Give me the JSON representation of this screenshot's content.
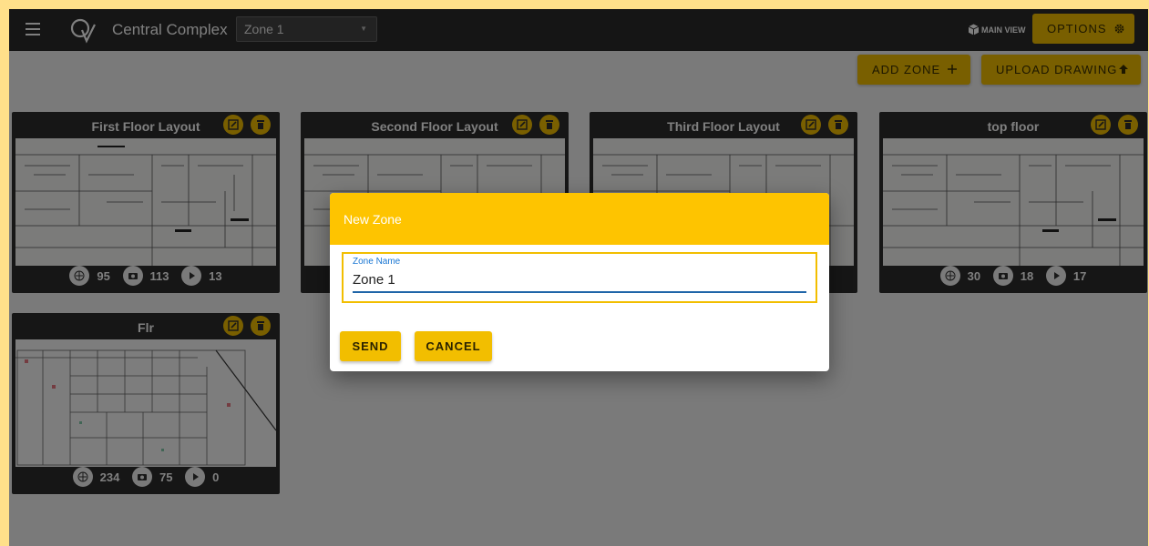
{
  "header": {
    "title": "Central Complex",
    "zone_select_value": "Zone 1",
    "main_view_label": "MAIN VIEW",
    "options_label": "OPTIONS"
  },
  "actions": {
    "add_zone_label": "ADD ZONE",
    "upload_drawing_label": "UPLOAD DRAWING"
  },
  "cards": [
    {
      "title": "First Floor Layout",
      "panoramas": "95",
      "photos": "113",
      "videos": "13"
    },
    {
      "title": "Second Floor Layout",
      "panoramas": "",
      "photos": "",
      "videos": ""
    },
    {
      "title": "Third Floor Layout",
      "panoramas": "",
      "photos": "",
      "videos": ""
    },
    {
      "title": "top floor",
      "panoramas": "30",
      "photos": "18",
      "videos": "17"
    },
    {
      "title": "Flr",
      "panoramas": "234",
      "photos": "75",
      "videos": "0"
    }
  ],
  "dialog": {
    "title": "New Zone",
    "field_label": "Zone Name",
    "field_value": "Zone 1",
    "send_label": "SEND",
    "cancel_label": "CANCEL"
  },
  "colors": {
    "accent": "#f2be00",
    "dialog_header": "#fec400",
    "topbar": "#2b2b2b",
    "card": "#2d2d2d",
    "input_underline": "#1f65a8"
  },
  "icons": {
    "menu": "menu-icon",
    "main_view": "cube-icon",
    "options": "gear-icon",
    "add": "plus-icon",
    "upload": "upload-arrow-icon",
    "edit": "edit-icon",
    "delete": "trash-icon",
    "panorama": "panorama-icon",
    "photo": "camera-icon",
    "video": "play-icon"
  }
}
